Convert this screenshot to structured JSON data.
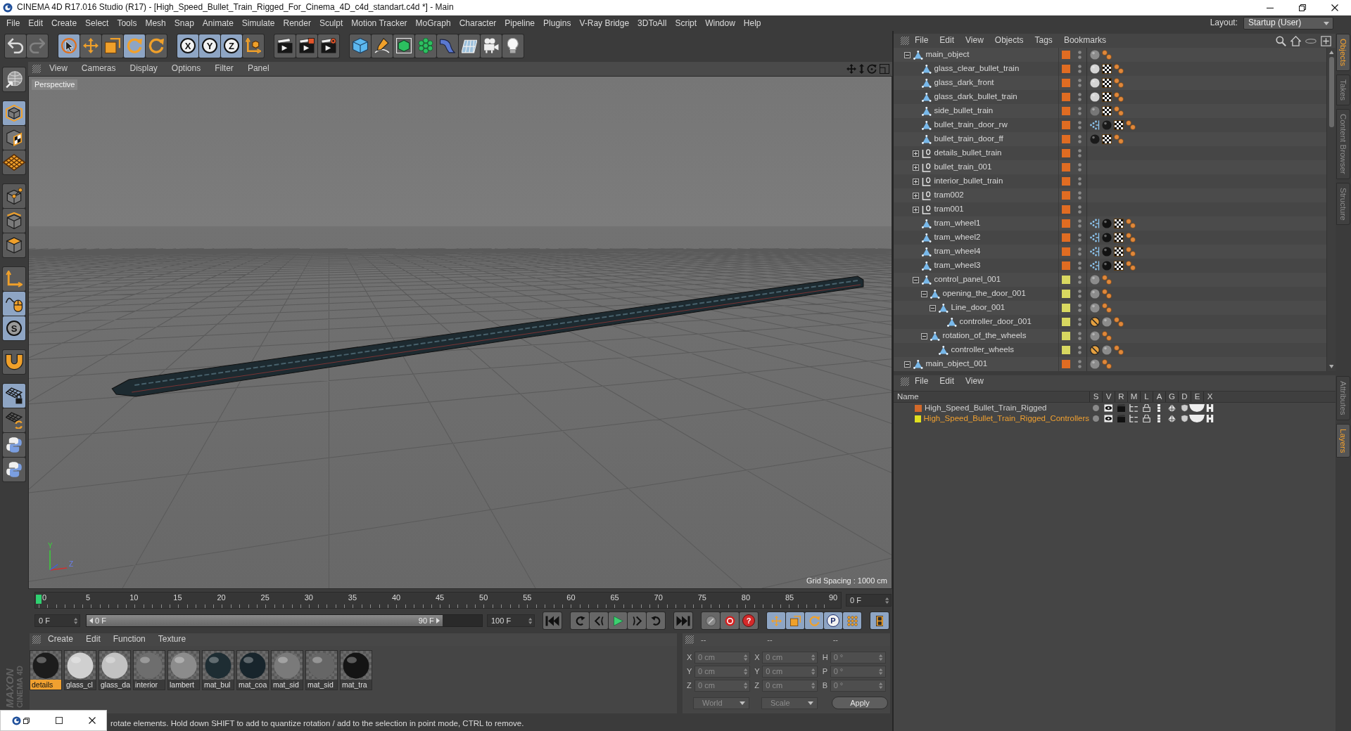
{
  "window": {
    "title": "CINEMA 4D R17.016 Studio (R17) - [High_Speed_Bullet_Train_Rigged_For_Cinema_4D_c4d_standart.c4d *] - Main"
  },
  "menu": [
    "File",
    "Edit",
    "Create",
    "Select",
    "Tools",
    "Mesh",
    "Snap",
    "Animate",
    "Simulate",
    "Render",
    "Sculpt",
    "Motion Tracker",
    "MoGraph",
    "Character",
    "Pipeline",
    "Plugins",
    "V-Ray Bridge",
    "3DToAll",
    "Script",
    "Window",
    "Help"
  ],
  "layout": {
    "label": "Layout:",
    "value": "Startup (User)"
  },
  "toolbar": [
    [
      {
        "kind": "undo",
        "on": false,
        "disabled": false
      },
      {
        "kind": "redo",
        "on": false,
        "disabled": true
      }
    ],
    [
      {
        "kind": "select",
        "on": true,
        "disabled": false
      },
      {
        "kind": "move",
        "on": false,
        "disabled": false
      },
      {
        "kind": "scale",
        "on": false,
        "disabled": false
      },
      {
        "kind": "rotate",
        "on": true,
        "disabled": false
      },
      {
        "kind": "rotate",
        "on": false,
        "disabled": false
      }
    ],
    [
      {
        "kind": "axis",
        "label": "X",
        "on": true,
        "disabled": false
      },
      {
        "kind": "axis",
        "label": "Y",
        "on": true,
        "disabled": false
      },
      {
        "kind": "axis",
        "label": "Z",
        "on": true,
        "disabled": false
      },
      {
        "kind": "coord",
        "on": false,
        "disabled": false
      }
    ],
    [
      {
        "kind": "render_view",
        "on": false,
        "disabled": false
      },
      {
        "kind": "render_picture",
        "on": false,
        "disabled": false
      },
      {
        "kind": "render_settings",
        "on": false,
        "disabled": false
      }
    ],
    [
      {
        "kind": "cube",
        "on": false,
        "disabled": false
      },
      {
        "kind": "pen",
        "on": false,
        "disabled": false
      },
      {
        "kind": "subdiv",
        "on": false,
        "disabled": false
      },
      {
        "kind": "cloner",
        "on": false,
        "disabled": false
      },
      {
        "kind": "bend",
        "on": false,
        "disabled": false
      },
      {
        "kind": "floor",
        "on": false,
        "disabled": false
      },
      {
        "kind": "camera",
        "on": false,
        "disabled": false
      },
      {
        "kind": "light",
        "on": false,
        "disabled": false
      }
    ]
  ],
  "tool_palette": [
    [
      {
        "kind": "editable",
        "on": false
      }
    ],
    [
      {
        "kind": "model",
        "on": true
      },
      {
        "kind": "texture",
        "on": false
      },
      {
        "kind": "workplane",
        "on": false
      }
    ],
    [
      {
        "kind": "points",
        "on": false
      },
      {
        "kind": "edges",
        "on": false
      },
      {
        "kind": "polygons",
        "on": false
      }
    ],
    [
      {
        "kind": "axis_mode",
        "on": false
      },
      {
        "kind": "tweak",
        "on": true
      },
      {
        "kind": "snap",
        "label": "S",
        "on": true
      }
    ],
    [
      {
        "kind": "magnet",
        "on": false
      }
    ],
    [
      {
        "kind": "plane_lock",
        "on": true
      },
      {
        "kind": "plane_rotate",
        "on": false
      },
      {
        "kind": "python",
        "on": false
      },
      {
        "kind": "python",
        "on": false
      }
    ]
  ],
  "logo": [
    "MAXON",
    "CINEMA 4D"
  ],
  "viewport": {
    "menu": [
      "View",
      "Cameras",
      "Display",
      "Options",
      "Filter",
      "Panel"
    ],
    "camera": "Perspective",
    "axis_labels": [
      "Y",
      "Z"
    ],
    "grid_spacing": "Grid Spacing : 1000 cm"
  },
  "timeline": {
    "ticks": [
      "0",
      "5",
      "10",
      "15",
      "20",
      "25",
      "30",
      "35",
      "40",
      "45",
      "50",
      "55",
      "60",
      "65",
      "70",
      "75",
      "80",
      "85",
      "90"
    ],
    "playhead": {
      "level": 0
    },
    "current": "0 F",
    "start": "0 F",
    "range": {
      "from": "0 F",
      "to": "90 F",
      "level": 0.9
    },
    "end": "100 F",
    "controls": [
      [
        {
          "kind": "first",
          "on": false
        }
      ],
      [
        {
          "kind": "prev_key",
          "on": false
        },
        {
          "kind": "prev_frame",
          "on": false
        },
        {
          "kind": "play",
          "on": false
        },
        {
          "kind": "next_frame",
          "on": false
        },
        {
          "kind": "next_key",
          "on": false
        }
      ],
      [
        {
          "kind": "last",
          "on": false
        }
      ],
      [
        {
          "kind": "key",
          "on": false
        },
        {
          "kind": "record",
          "on": false
        },
        {
          "kind": "autokey",
          "label": "?",
          "on": false
        }
      ],
      [
        {
          "kind": "move",
          "on": true
        },
        {
          "kind": "scale",
          "on": true
        },
        {
          "kind": "rotate",
          "on": true
        },
        {
          "kind": "param",
          "label": "P",
          "on": true
        },
        {
          "kind": "dots",
          "on": true
        }
      ],
      [
        {
          "kind": "film",
          "on": true
        }
      ]
    ]
  },
  "materials": {
    "menu": [
      "Create",
      "Edit",
      "Function",
      "Texture"
    ],
    "items": [
      {
        "name": "details",
        "color": "#1c1c1c",
        "selected": true
      },
      {
        "name": "glass_cl",
        "color": "#d0d0d0",
        "selected": false
      },
      {
        "name": "glass_da",
        "color": "#c2c2c2",
        "selected": false
      },
      {
        "name": "interior",
        "color": "#6e6e6e",
        "selected": false
      },
      {
        "name": "lambert",
        "color": "#8c8c8c",
        "selected": false
      },
      {
        "name": "mat_bul",
        "color": "#1e2d33",
        "selected": false
      },
      {
        "name": "mat_coa",
        "color": "#18252c",
        "selected": false
      },
      {
        "name": "mat_sid",
        "color": "#7a7a7a",
        "selected": false
      },
      {
        "name": "mat_sid",
        "color": "#666666",
        "selected": false
      },
      {
        "name": "mat_tra",
        "color": "#141414",
        "selected": false
      }
    ]
  },
  "coordinates": {
    "disabled": true,
    "headers": [
      "--",
      "--",
      "--"
    ],
    "rows": [
      [
        {
          "label": "X",
          "value": "0 cm"
        },
        {
          "label": "X",
          "value": "0 cm"
        },
        {
          "label": "H",
          "value": "0 °"
        }
      ],
      [
        {
          "label": "Y",
          "value": "0 cm"
        },
        {
          "label": "Y",
          "value": "0 cm"
        },
        {
          "label": "P",
          "value": "0 °"
        }
      ],
      [
        {
          "label": "Z",
          "value": "0 cm"
        },
        {
          "label": "Z",
          "value": "0 cm"
        },
        {
          "label": "B",
          "value": "0 °"
        }
      ]
    ],
    "dropdowns": [
      "World",
      "Scale"
    ],
    "apply": "Apply"
  },
  "status_bar": "rotate elements. Hold down SHIFT to add to quantize rotation / add to the selection in point mode, CTRL to remove.",
  "objects": {
    "menu": [
      "File",
      "Edit",
      "View",
      "Objects",
      "Tags",
      "Bookmarks"
    ],
    "rows": [
      {
        "name": "main_object",
        "kind": "polygon",
        "color": "#e06c22",
        "expanded": true,
        "tags": [
          {
            "kind": "material",
            "color": "#8c8c8c"
          },
          {
            "kind": "phong"
          }
        ],
        "children": [
          {
            "name": "glass_clear_bullet_train",
            "kind": "polygon",
            "color": "#e06c22",
            "tags": [
              {
                "kind": "material",
                "color": "#d4d4d4"
              },
              {
                "kind": "uvw"
              },
              {
                "kind": "phong"
              }
            ]
          },
          {
            "name": "glass_dark_front",
            "kind": "polygon",
            "color": "#e06c22",
            "tags": [
              {
                "kind": "material",
                "color": "#d4d4d4"
              },
              {
                "kind": "uvw"
              },
              {
                "kind": "phong"
              }
            ]
          },
          {
            "name": "glass_dark_bullet_train",
            "kind": "polygon",
            "color": "#e06c22",
            "tags": [
              {
                "kind": "material",
                "color": "#d4d4d4"
              },
              {
                "kind": "uvw"
              },
              {
                "kind": "phong"
              }
            ]
          },
          {
            "name": "side_bullet_train",
            "kind": "polygon",
            "color": "#e06c22",
            "tags": [
              {
                "kind": "material",
                "color": "#777777"
              },
              {
                "kind": "uvw"
              },
              {
                "kind": "phong"
              }
            ]
          },
          {
            "name": "bullet_train_door_rw",
            "kind": "polygon",
            "color": "#e06c22",
            "tags": [
              {
                "kind": "weight"
              },
              {
                "kind": "material",
                "color": "#1a1a1a"
              },
              {
                "kind": "uvw"
              },
              {
                "kind": "phong"
              }
            ]
          },
          {
            "name": "bullet_train_door_ff",
            "kind": "polygon",
            "color": "#e06c22",
            "tags": [
              {
                "kind": "material",
                "color": "#1a1a1a"
              },
              {
                "kind": "uvw"
              },
              {
                "kind": "phong"
              }
            ]
          },
          {
            "name": "details_bullet_train",
            "kind": "null",
            "color": "#e06c22",
            "expanded": false
          },
          {
            "name": "bullet_train_001",
            "kind": "null",
            "color": "#e06c22",
            "expanded": false
          },
          {
            "name": "interior_bullet_train",
            "kind": "null",
            "color": "#e06c22",
            "expanded": false
          },
          {
            "name": "tram002",
            "kind": "null",
            "color": "#e06c22",
            "expanded": false
          },
          {
            "name": "tram001",
            "kind": "null",
            "color": "#e06c22",
            "expanded": false
          },
          {
            "name": "tram_wheel1",
            "kind": "polygon",
            "color": "#e06c22",
            "tags": [
              {
                "kind": "weight"
              },
              {
                "kind": "material",
                "color": "#121212"
              },
              {
                "kind": "uvw"
              },
              {
                "kind": "phong"
              }
            ]
          },
          {
            "name": "tram_wheel2",
            "kind": "polygon",
            "color": "#e06c22",
            "tags": [
              {
                "kind": "weight"
              },
              {
                "kind": "material",
                "color": "#121212"
              },
              {
                "kind": "uvw"
              },
              {
                "kind": "phong"
              }
            ]
          },
          {
            "name": "tram_wheel4",
            "kind": "polygon",
            "color": "#e06c22",
            "tags": [
              {
                "kind": "weight"
              },
              {
                "kind": "material",
                "color": "#121212"
              },
              {
                "kind": "uvw"
              },
              {
                "kind": "phong"
              }
            ]
          },
          {
            "name": "tram_wheel3",
            "kind": "polygon",
            "color": "#e06c22",
            "tags": [
              {
                "kind": "weight"
              },
              {
                "kind": "material",
                "color": "#121212"
              },
              {
                "kind": "uvw"
              },
              {
                "kind": "phong"
              }
            ]
          },
          {
            "name": "control_panel_001",
            "kind": "polygon",
            "color": "#d8d860",
            "expanded": true,
            "tags": [
              {
                "kind": "material",
                "color": "#8c8c8c"
              },
              {
                "kind": "phong"
              }
            ],
            "children": [
              {
                "name": "opening_the_door_001",
                "kind": "polygon",
                "color": "#d8d860",
                "expanded": true,
                "tags": [
                  {
                    "kind": "material",
                    "color": "#8c8c8c"
                  },
                  {
                    "kind": "phong"
                  }
                ],
                "children": [
                  {
                    "name": "Line_door_001",
                    "kind": "polygon",
                    "color": "#d8d860",
                    "expanded": true,
                    "tags": [
                      {
                        "kind": "material",
                        "color": "#8c8c8c"
                      },
                      {
                        "kind": "phong"
                      }
                    ],
                    "children": [
                      {
                        "name": "controller_door_001",
                        "kind": "polygon",
                        "color": "#d8d860",
                        "tags": [
                          {
                            "kind": "protection"
                          },
                          {
                            "kind": "material",
                            "color": "#8c8c8c"
                          },
                          {
                            "kind": "phong"
                          }
                        ]
                      }
                    ]
                  }
                ]
              },
              {
                "name": "rotation_of_the_wheels",
                "kind": "polygon",
                "color": "#d8d860",
                "expanded": true,
                "tags": [
                  {
                    "kind": "material",
                    "color": "#8c8c8c"
                  },
                  {
                    "kind": "phong"
                  }
                ],
                "children": [
                  {
                    "name": "controller_wheels",
                    "kind": "polygon",
                    "color": "#d8d860",
                    "tags": [
                      {
                        "kind": "protection"
                      },
                      {
                        "kind": "material",
                        "color": "#8c8c8c"
                      },
                      {
                        "kind": "phong"
                      }
                    ]
                  }
                ]
              }
            ]
          }
        ]
      },
      {
        "name": "main_object_001",
        "kind": "polygon",
        "color": "#e06c22",
        "expanded": true,
        "tags": [
          {
            "kind": "material",
            "color": "#8c8c8c"
          },
          {
            "kind": "phong"
          }
        ]
      }
    ]
  },
  "layers": {
    "menu": [
      "File",
      "Edit",
      "View"
    ],
    "columns": [
      "Name",
      "S",
      "V",
      "R",
      "M",
      "L",
      "A",
      "G",
      "D",
      "E",
      "X"
    ],
    "rows": [
      {
        "name": "High_Speed_Bullet_Train_Rigged",
        "color": "#d2692a",
        "selected": false
      },
      {
        "name": "High_Speed_Bullet_Train_Rigged_Controllers",
        "color": "#e0e020",
        "selected": true
      }
    ]
  },
  "side_tabs": {
    "top": [
      {
        "label": "Objects",
        "selected": true
      },
      {
        "label": "Takes",
        "selected": false
      },
      {
        "label": "Content Browser",
        "selected": false
      },
      {
        "label": "Structure",
        "selected": false
      }
    ],
    "bottom": [
      {
        "label": "Attributes",
        "selected": false
      },
      {
        "label": "Layers",
        "selected": true
      }
    ]
  }
}
